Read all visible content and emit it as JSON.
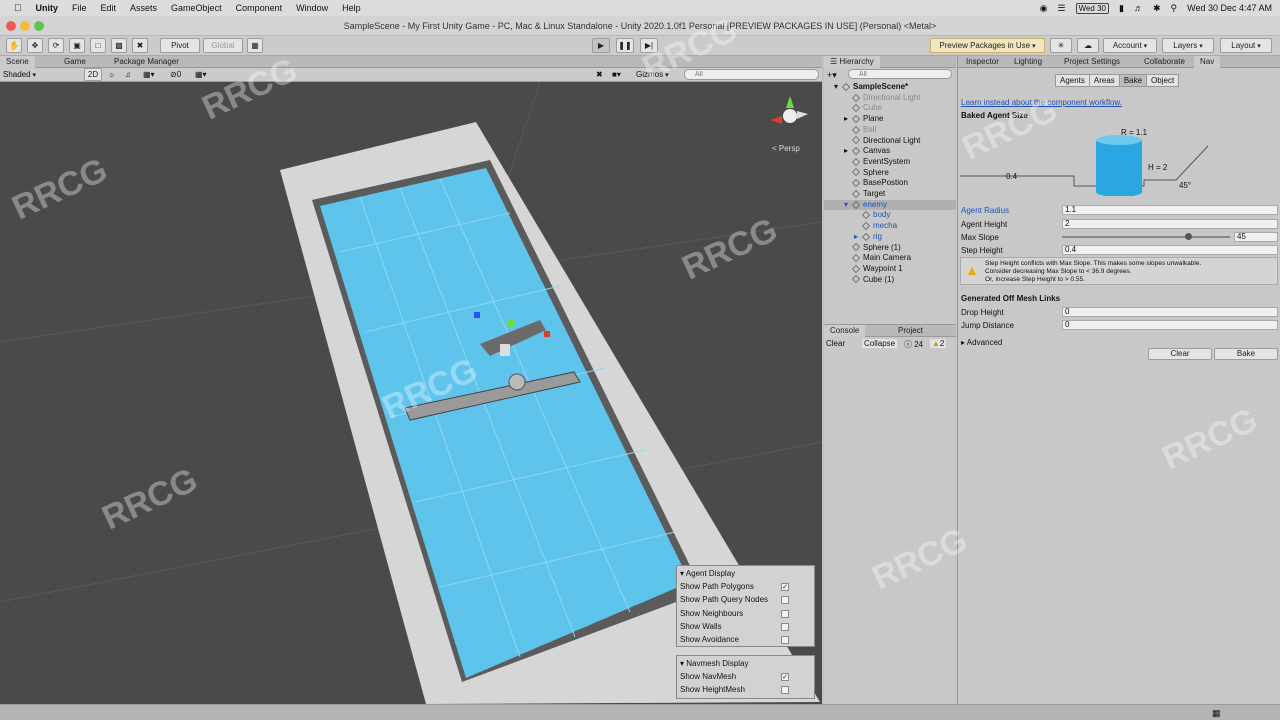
{
  "menubar": {
    "app": "Unity",
    "items": [
      "File",
      "Edit",
      "Assets",
      "GameObject",
      "Component",
      "Window",
      "Help"
    ],
    "day_badge": "Wed 30",
    "clock": "Wed 30 Dec  4:47 AM"
  },
  "title": "SampleScene - My First Unity Game - PC, Mac & Linux Standalone - Unity 2020.1.0f1 Personal [PREVIEW PACKAGES IN USE] (Personal) <Metal>",
  "toolbar": {
    "pivot": "Pivot",
    "global": "Global",
    "preview": "Preview Packages in Use",
    "account": "Account",
    "layers": "Layers",
    "layout": "Layout"
  },
  "scene": {
    "tabs": [
      "Scene",
      "Game",
      "Package Manager"
    ],
    "shading": "Shaded",
    "mode2d": "2D",
    "gizmos": "Gizmos",
    "search_placeholder": "All",
    "fx_count": "0",
    "persp": "< Persp"
  },
  "hierarchy": {
    "tab": "Hierarchy",
    "search_placeholder": "All",
    "rows": [
      {
        "label": "SampleScene*",
        "style": "bold"
      },
      {
        "label": "Directional Light",
        "style": "dim"
      },
      {
        "label": "Cube",
        "style": "dim"
      },
      {
        "label": "Plane",
        "style": ""
      },
      {
        "label": "Ball",
        "style": "dim"
      },
      {
        "label": "Directional Light",
        "style": ""
      },
      {
        "label": "Canvas",
        "style": ""
      },
      {
        "label": "EventSystem",
        "style": ""
      },
      {
        "label": "Sphere",
        "style": ""
      },
      {
        "label": "BasePostion",
        "style": ""
      },
      {
        "label": "Target",
        "style": ""
      },
      {
        "label": "enemy",
        "style": "blue sel"
      },
      {
        "label": "body",
        "style": "blue"
      },
      {
        "label": "mecha",
        "style": "blue"
      },
      {
        "label": "rig",
        "style": "blue"
      },
      {
        "label": "Sphere (1)",
        "style": ""
      },
      {
        "label": "Main Camera",
        "style": ""
      },
      {
        "label": "Waypoint 1",
        "style": ""
      },
      {
        "label": "Cube (1)",
        "style": ""
      }
    ]
  },
  "console": {
    "tabs": [
      "Console",
      "Project"
    ],
    "clear": "Clear",
    "collapse": "Collapse",
    "info_count": "24",
    "warn_count": "2"
  },
  "inspector": {
    "tabs": [
      "Inspector",
      "Lighting",
      "Project Settings",
      "Collaborate",
      "Nav"
    ],
    "subtabs": [
      "Agents",
      "Areas",
      "Bake",
      "Object"
    ],
    "link": "Learn instead about the component workflow.",
    "baked_header": "Baked Agent Size",
    "diagram": {
      "r": "R = 1.1",
      "h": "H = 2",
      "step": "0.4",
      "angle": "45°"
    },
    "fields": [
      {
        "label": "Agent Radius",
        "value": "1.1"
      },
      {
        "label": "Agent Height",
        "value": "2"
      },
      {
        "label": "Max Slope",
        "value": "45"
      },
      {
        "label": "Step Height",
        "value": "0.4"
      }
    ],
    "slope_fraction": 0.75,
    "warning": [
      "Step Height conflicts with Max Slope. This makes some slopes unwalkable.",
      "Consider decreasing Max Slope to < 36.9 degrees.",
      "Or, increase Step Height to > 0.55."
    ],
    "offmesh_header": "Generated Off Mesh Links",
    "drop_label": "Drop Height",
    "drop_value": "0",
    "jump_label": "Jump Distance",
    "jump_value": "0",
    "advanced": "Advanced",
    "clear_btn": "Clear",
    "bake_btn": "Bake"
  },
  "agent_display": {
    "header": "Agent Display",
    "rows": [
      {
        "label": "Show Path Polygons",
        "checked": true
      },
      {
        "label": "Show Path Query Nodes",
        "checked": false
      },
      {
        "label": "Show Neighbours",
        "checked": false
      },
      {
        "label": "Show Walls",
        "checked": false
      },
      {
        "label": "Show Avoidance",
        "checked": false
      }
    ]
  },
  "navmesh_display": {
    "header": "Navmesh Display",
    "rows": [
      {
        "label": "Show NavMesh",
        "checked": true
      },
      {
        "label": "Show HeightMesh",
        "checked": false
      }
    ]
  },
  "watermark": "RRCG",
  "colors": {
    "navmesh": "#5fc4ec",
    "accent": "#1f4fb8"
  }
}
